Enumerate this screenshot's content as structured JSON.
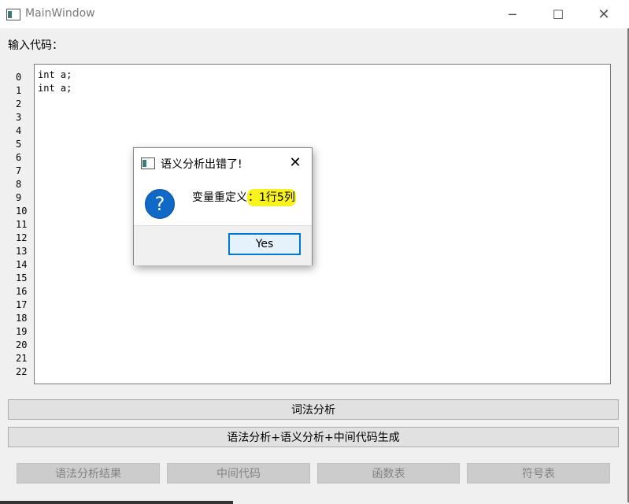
{
  "window": {
    "title": "MainWindow"
  },
  "label_input": "输入代码：",
  "line_numbers": [
    "0",
    "1",
    "2",
    "3",
    "4",
    "5",
    "6",
    "7",
    "8",
    "9",
    "10",
    "11",
    "12",
    "13",
    "14",
    "15",
    "16",
    "17",
    "18",
    "19",
    "20",
    "21",
    "22"
  ],
  "editor": {
    "code": "int a;\nint a;"
  },
  "buttons": {
    "lexical": "词法分析",
    "syntax_semantic": "语法分析+语义分析+中间代码生成",
    "syntax_result": "语法分析结果",
    "intermediate_code": "中间代码",
    "function_table": "函数表",
    "symbol_table": "符号表"
  },
  "dialog": {
    "title": "语义分析出错了!",
    "message_prefix": "变量重定义",
    "message_highlight": "：1行5列",
    "yes": "Yes"
  },
  "colors": {
    "highlight": "#f8f31c",
    "accent": "#0078d7",
    "question_icon": "#1068c7"
  },
  "icons": [
    "app-icon",
    "minimize-icon",
    "maximize-icon",
    "close-icon",
    "question-icon"
  ]
}
